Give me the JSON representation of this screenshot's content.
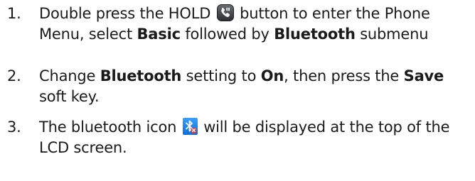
{
  "steps": [
    {
      "number": "1.",
      "text_a": "Double press the HOLD",
      "icon": "hold-button-icon",
      "text_b": "button to enter the Phone Menu, select",
      "bold_1": "Basic",
      "text_c": "followed by",
      "bold_2": "Bluetooth",
      "text_d": "submenu"
    },
    {
      "number": "2.",
      "text_a": "Change",
      "bold_1": "Bluetooth",
      "text_b": "setting to",
      "bold_2": "On",
      "text_c": ", then press the",
      "bold_3": "Save",
      "text_d": "soft key."
    },
    {
      "number": "3.",
      "text_a": "The bluetooth icon",
      "icon": "bluetooth-status-icon",
      "text_b": "will be displayed at the top of the LCD screen."
    }
  ],
  "colors": {
    "text": "#1a1a1a",
    "hold_icon_bg": "#3d3f45",
    "bluetooth_bg": "#1e88e5",
    "bluetooth_x": "#e53935"
  }
}
